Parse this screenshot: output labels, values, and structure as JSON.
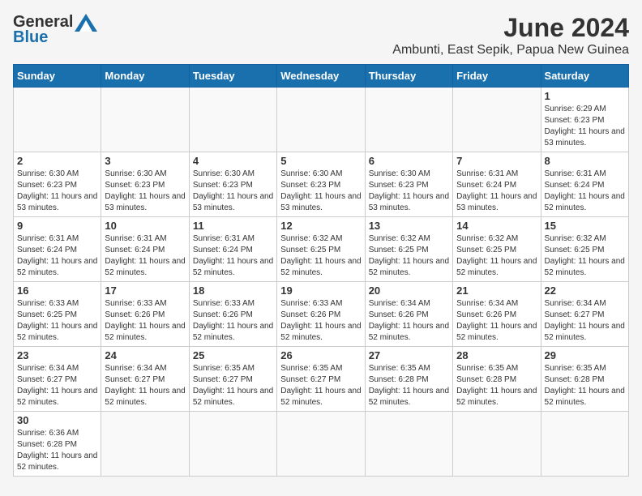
{
  "header": {
    "logo_general": "General",
    "logo_blue": "Blue",
    "month_title": "June 2024",
    "location": "Ambunti, East Sepik, Papua New Guinea"
  },
  "days_of_week": [
    "Sunday",
    "Monday",
    "Tuesday",
    "Wednesday",
    "Thursday",
    "Friday",
    "Saturday"
  ],
  "weeks": [
    [
      {
        "day": null,
        "info": null
      },
      {
        "day": null,
        "info": null
      },
      {
        "day": null,
        "info": null
      },
      {
        "day": null,
        "info": null
      },
      {
        "day": null,
        "info": null
      },
      {
        "day": null,
        "info": null
      },
      {
        "day": "1",
        "info": "Sunrise: 6:29 AM\nSunset: 6:23 PM\nDaylight: 11 hours and 53 minutes."
      }
    ],
    [
      {
        "day": "2",
        "info": "Sunrise: 6:30 AM\nSunset: 6:23 PM\nDaylight: 11 hours and 53 minutes."
      },
      {
        "day": "3",
        "info": "Sunrise: 6:30 AM\nSunset: 6:23 PM\nDaylight: 11 hours and 53 minutes."
      },
      {
        "day": "4",
        "info": "Sunrise: 6:30 AM\nSunset: 6:23 PM\nDaylight: 11 hours and 53 minutes."
      },
      {
        "day": "5",
        "info": "Sunrise: 6:30 AM\nSunset: 6:23 PM\nDaylight: 11 hours and 53 minutes."
      },
      {
        "day": "6",
        "info": "Sunrise: 6:30 AM\nSunset: 6:23 PM\nDaylight: 11 hours and 53 minutes."
      },
      {
        "day": "7",
        "info": "Sunrise: 6:31 AM\nSunset: 6:24 PM\nDaylight: 11 hours and 53 minutes."
      },
      {
        "day": "8",
        "info": "Sunrise: 6:31 AM\nSunset: 6:24 PM\nDaylight: 11 hours and 52 minutes."
      }
    ],
    [
      {
        "day": "9",
        "info": "Sunrise: 6:31 AM\nSunset: 6:24 PM\nDaylight: 11 hours and 52 minutes."
      },
      {
        "day": "10",
        "info": "Sunrise: 6:31 AM\nSunset: 6:24 PM\nDaylight: 11 hours and 52 minutes."
      },
      {
        "day": "11",
        "info": "Sunrise: 6:31 AM\nSunset: 6:24 PM\nDaylight: 11 hours and 52 minutes."
      },
      {
        "day": "12",
        "info": "Sunrise: 6:32 AM\nSunset: 6:25 PM\nDaylight: 11 hours and 52 minutes."
      },
      {
        "day": "13",
        "info": "Sunrise: 6:32 AM\nSunset: 6:25 PM\nDaylight: 11 hours and 52 minutes."
      },
      {
        "day": "14",
        "info": "Sunrise: 6:32 AM\nSunset: 6:25 PM\nDaylight: 11 hours and 52 minutes."
      },
      {
        "day": "15",
        "info": "Sunrise: 6:32 AM\nSunset: 6:25 PM\nDaylight: 11 hours and 52 minutes."
      }
    ],
    [
      {
        "day": "16",
        "info": "Sunrise: 6:33 AM\nSunset: 6:25 PM\nDaylight: 11 hours and 52 minutes."
      },
      {
        "day": "17",
        "info": "Sunrise: 6:33 AM\nSunset: 6:26 PM\nDaylight: 11 hours and 52 minutes."
      },
      {
        "day": "18",
        "info": "Sunrise: 6:33 AM\nSunset: 6:26 PM\nDaylight: 11 hours and 52 minutes."
      },
      {
        "day": "19",
        "info": "Sunrise: 6:33 AM\nSunset: 6:26 PM\nDaylight: 11 hours and 52 minutes."
      },
      {
        "day": "20",
        "info": "Sunrise: 6:34 AM\nSunset: 6:26 PM\nDaylight: 11 hours and 52 minutes."
      },
      {
        "day": "21",
        "info": "Sunrise: 6:34 AM\nSunset: 6:26 PM\nDaylight: 11 hours and 52 minutes."
      },
      {
        "day": "22",
        "info": "Sunrise: 6:34 AM\nSunset: 6:27 PM\nDaylight: 11 hours and 52 minutes."
      }
    ],
    [
      {
        "day": "23",
        "info": "Sunrise: 6:34 AM\nSunset: 6:27 PM\nDaylight: 11 hours and 52 minutes."
      },
      {
        "day": "24",
        "info": "Sunrise: 6:34 AM\nSunset: 6:27 PM\nDaylight: 11 hours and 52 minutes."
      },
      {
        "day": "25",
        "info": "Sunrise: 6:35 AM\nSunset: 6:27 PM\nDaylight: 11 hours and 52 minutes."
      },
      {
        "day": "26",
        "info": "Sunrise: 6:35 AM\nSunset: 6:27 PM\nDaylight: 11 hours and 52 minutes."
      },
      {
        "day": "27",
        "info": "Sunrise: 6:35 AM\nSunset: 6:28 PM\nDaylight: 11 hours and 52 minutes."
      },
      {
        "day": "28",
        "info": "Sunrise: 6:35 AM\nSunset: 6:28 PM\nDaylight: 11 hours and 52 minutes."
      },
      {
        "day": "29",
        "info": "Sunrise: 6:35 AM\nSunset: 6:28 PM\nDaylight: 11 hours and 52 minutes."
      }
    ],
    [
      {
        "day": "30",
        "info": "Sunrise: 6:36 AM\nSunset: 6:28 PM\nDaylight: 11 hours and 52 minutes."
      },
      {
        "day": null,
        "info": null
      },
      {
        "day": null,
        "info": null
      },
      {
        "day": null,
        "info": null
      },
      {
        "day": null,
        "info": null
      },
      {
        "day": null,
        "info": null
      },
      {
        "day": null,
        "info": null
      }
    ]
  ]
}
